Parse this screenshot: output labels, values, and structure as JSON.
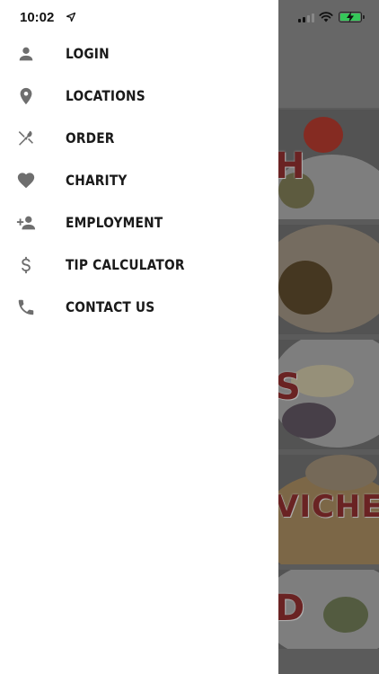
{
  "status_bar": {
    "time": "10:02"
  },
  "drawer": {
    "items": [
      {
        "label": "LOGIN",
        "icon": "person-icon"
      },
      {
        "label": "LOCATIONS",
        "icon": "location-pin-icon"
      },
      {
        "label": "ORDER",
        "icon": "utensils-icon"
      },
      {
        "label": "CHARITY",
        "icon": "heart-icon"
      },
      {
        "label": "EMPLOYMENT",
        "icon": "add-person-icon"
      },
      {
        "label": "TIP CALCULATOR",
        "icon": "dollar-icon"
      },
      {
        "label": "CONTACT US",
        "icon": "phone-icon"
      }
    ]
  },
  "background": {
    "tiles": [
      {
        "label": "H"
      },
      {
        "label": ""
      },
      {
        "label": "S"
      },
      {
        "label": "VICHES"
      },
      {
        "label": "D"
      }
    ]
  }
}
